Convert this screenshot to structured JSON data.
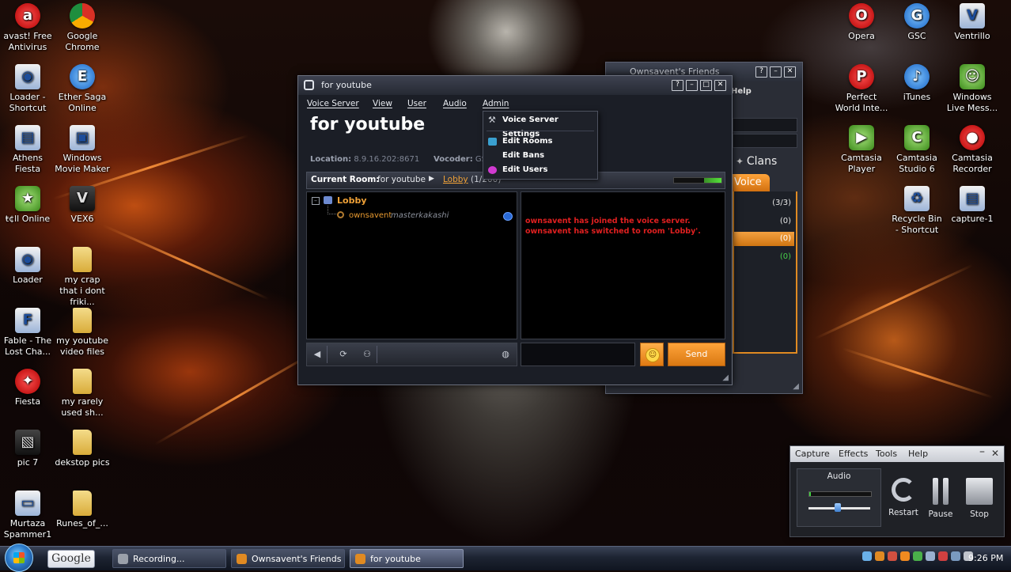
{
  "desktop": {
    "icons_left": [
      {
        "label": "avast! Free Antivirus",
        "icon": "avast-icon"
      },
      {
        "label": "Google Chrome",
        "icon": "chrome-icon"
      },
      {
        "label": "Loader - Shortcut",
        "icon": "loader-icon"
      },
      {
        "label": "Ether Saga Online",
        "icon": "ether-saga-icon"
      },
      {
        "label": "Athens Fiesta",
        "icon": "app-icon"
      },
      {
        "label": "Windows Movie Maker",
        "icon": "movie-maker-icon"
      },
      {
        "label": "ŧ¢ll Online",
        "icon": "game-icon"
      },
      {
        "label": "VEX6",
        "icon": "vex-icon"
      },
      {
        "label": "Loader",
        "icon": "loader-icon"
      },
      {
        "label": "my crap that i dont friki...",
        "icon": "folder-icon"
      },
      {
        "label": "Fable - The Lost Cha...",
        "icon": "fable-icon"
      },
      {
        "label": "my youtube video files",
        "icon": "folder-icon"
      },
      {
        "label": "Fiesta",
        "icon": "fiesta-icon"
      },
      {
        "label": "my rarely used sh...",
        "icon": "folder-icon"
      },
      {
        "label": "pic 7",
        "icon": "image-icon"
      },
      {
        "label": "dekstop pics",
        "icon": "folder-icon"
      },
      {
        "label": "Murtaza Spammer1",
        "icon": "app-icon"
      },
      {
        "label": "Runes_of_...",
        "icon": "folder-icon"
      }
    ],
    "icons_right": [
      {
        "label": "Opera",
        "icon": "opera-icon"
      },
      {
        "label": "GSC",
        "icon": "gsc-icon"
      },
      {
        "label": "Ventrillo",
        "icon": "ventrilo-icon"
      },
      {
        "label": "Perfect World Inte...",
        "icon": "perfect-world-icon"
      },
      {
        "label": "iTunes",
        "icon": "itunes-icon"
      },
      {
        "label": "Windows Live Mess...",
        "icon": "live-messenger-icon"
      },
      {
        "label": "Camtasia Player",
        "icon": "camtasia-player-icon"
      },
      {
        "label": "Camtasia Studio 6",
        "icon": "camtasia-studio-icon"
      },
      {
        "label": "Camtasia Recorder",
        "icon": "camtasia-recorder-icon"
      },
      {
        "label": "Recycle Bin - Shortcut",
        "icon": "recycle-bin-icon"
      },
      {
        "label": "capture-1",
        "icon": "file-icon"
      }
    ]
  },
  "friends_window": {
    "title": "Ownsavent's Friends",
    "help": "Help",
    "clans_tab": "Clans",
    "voice_tab": "Voice",
    "rows": [
      "(3/3)",
      "(0)",
      "(0)",
      "(0)"
    ]
  },
  "voice_window": {
    "title": "for youtube",
    "menu": [
      "Voice Server",
      "View",
      "User",
      "Audio",
      "Admin"
    ],
    "server_name": "for youtube",
    "location_label": "Location:",
    "location_value": "8.9.16.202:8671",
    "vocoder_label": "Vocoder:",
    "vocoder_value": "GS",
    "current_room_label": "Current Room:",
    "current_room_name": "for youtube",
    "current_room_link": "Lobby",
    "current_room_count": "(1/200)",
    "tree": {
      "room": "Lobby",
      "user": "ownsavent",
      "user_comment": "masterkakashi"
    },
    "chat_lines": [
      "ownsavent has joined the voice server.",
      "ownsavent has switched to room 'Lobby'."
    ],
    "send_label": "Send"
  },
  "admin_menu": {
    "items": [
      "Voice Server Settings",
      "Edit Rooms",
      "Edit Bans",
      "Edit Users"
    ]
  },
  "recorder": {
    "menu": [
      "Capture",
      "Effects",
      "Tools",
      "Help"
    ],
    "audio_label": "Audio",
    "restart": "Restart",
    "pause": "Pause",
    "stop": "Stop"
  },
  "taskbar": {
    "google": "Google",
    "tasks": [
      "Recording...",
      "Ownsavent's Friends",
      "for youtube"
    ],
    "clock": "9:26 PM"
  },
  "colors": {
    "accent_orange": "#f0a238",
    "chat_red": "#e02020"
  }
}
